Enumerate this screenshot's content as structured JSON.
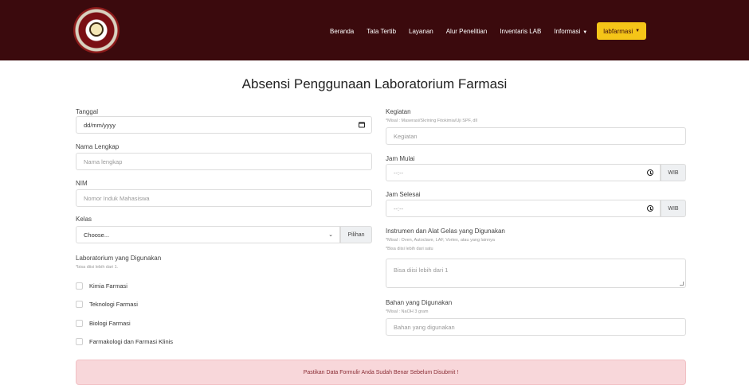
{
  "nav": {
    "links": [
      "Beranda",
      "Tata Tertib",
      "Layanan",
      "Alur Penelitian",
      "Inventaris LAB",
      "Informasi"
    ],
    "button": "labfarmasi"
  },
  "title": "Absensi Penggunaan Laboratorium Farmasi",
  "left": {
    "tanggal_label": "Tanggal",
    "tanggal_value": "dd/mm/yyyy",
    "nama_label": "Nama Lengkap",
    "nama_placeholder": "Nama lengkap",
    "nim_label": "NIM",
    "nim_placeholder": "Nomor Induk Mahasiswa",
    "kelas_label": "Kelas",
    "kelas_value": "Choose...",
    "kelas_addon": "Pilihan",
    "lab_label": "Laboratorium yang Digunakan",
    "lab_hint": "*bisa diisi lebih dari 1.",
    "labs": [
      "Kimia Farmasi",
      "Teknologi Farmasi",
      "Biologi Farmasi",
      "Farmakologi dan Farmasi Klinis"
    ]
  },
  "right": {
    "kegiatan_label": "Kegiatan",
    "kegiatan_hint": "*Misal : Maserasi/Skrining Fitokimia/Uji SPF, dll",
    "kegiatan_placeholder": "Kegiatan",
    "mulai_label": "Jam Mulai",
    "mulai_value": "--:--",
    "mulai_addon": "WIB",
    "selesai_label": "Jam Selesai",
    "selesai_value": "--:--",
    "selesai_addon": "WIB",
    "instrumen_label": "Instrumen dan Alat Gelas yang Digunakan",
    "instrumen_hint1": "*Misal : Oven, Autoclave, LAF, Vortex, atau yang lainnya",
    "instrumen_hint2": "*Bisa diisi lebih dari satu",
    "instrumen_placeholder": "Bisa diisi lebih dari 1",
    "bahan_label": "Bahan yang Digunakan",
    "bahan_hint": "*Misal : NaOH 3 gram",
    "bahan_placeholder": "Bahan yang digunakan"
  },
  "alert": "Pastikan Data Formulir Anda Sudah Benar Sebelum Disubmit !"
}
